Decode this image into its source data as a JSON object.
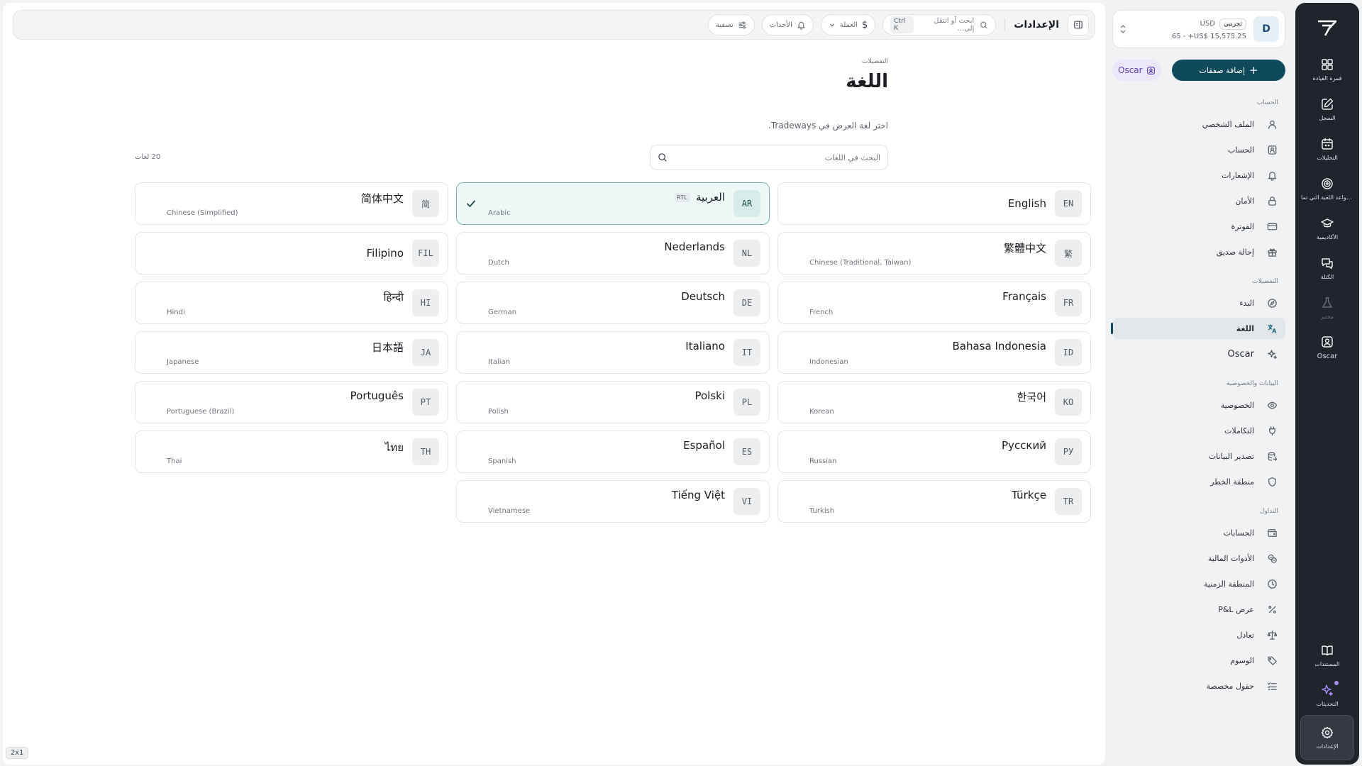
{
  "app": {
    "logo_label": "Tradeways"
  },
  "rail": {
    "items": [
      {
        "icon": "dashboard-icon",
        "label": "قمرة القيادة"
      },
      {
        "icon": "journal-icon",
        "label": "السجل"
      },
      {
        "icon": "analytics-icon",
        "label": "التحليلات"
      },
      {
        "icon": "target-icon",
        "label": "قواعد اللعبة التي تما..."
      },
      {
        "icon": "academy-icon",
        "label": "الأكاديمية"
      },
      {
        "icon": "chat-icon",
        "label": "الكتلة"
      },
      {
        "icon": "lab-icon",
        "label": "مختبر"
      },
      {
        "icon": "oscar-icon",
        "label": "Oscar"
      }
    ],
    "bottom": [
      {
        "icon": "docs-icon",
        "label": "المستندات"
      },
      {
        "icon": "updates-icon",
        "label": "التحديثات"
      },
      {
        "icon": "settings-icon",
        "label": "الإعدادات"
      }
    ]
  },
  "account": {
    "avatar": "D",
    "mode": "تجريبي",
    "currency": "USD",
    "balance": "65 - +US$ 15,575.25"
  },
  "actions": {
    "add_trades": "إضافة صفقات",
    "oscar": "Oscar"
  },
  "sidebar": {
    "sections": [
      {
        "title": "الحساب",
        "items": [
          {
            "icon": "user-icon",
            "label": "الملف الشخصي"
          },
          {
            "icon": "account-card-icon",
            "label": "الحساب"
          },
          {
            "icon": "bell-icon",
            "label": "الإشعارات"
          },
          {
            "icon": "lock-icon",
            "label": "الأمان"
          },
          {
            "icon": "credit-card-icon",
            "label": "الفوترة"
          },
          {
            "icon": "gift-icon",
            "label": "إحالة صديق"
          }
        ]
      },
      {
        "title": "التفضيلات",
        "items": [
          {
            "icon": "compass-icon",
            "label": "البدء"
          },
          {
            "icon": "translate-icon",
            "label": "اللغة"
          },
          {
            "icon": "sparkle-icon",
            "label": "Oscar"
          }
        ]
      },
      {
        "title": "البيانات والخصوصية",
        "items": [
          {
            "icon": "eye-icon",
            "label": "الخصوصية"
          },
          {
            "icon": "plug-icon",
            "label": "التكاملات"
          },
          {
            "icon": "database-export-icon",
            "label": "تصدير البيانات"
          },
          {
            "icon": "shield-icon",
            "label": "منطقة الخطر"
          }
        ]
      },
      {
        "title": "التداول",
        "items": [
          {
            "icon": "wallet-icon",
            "label": "الحسابات"
          },
          {
            "icon": "instruments-icon",
            "label": "الأدوات المالية"
          },
          {
            "icon": "clock-icon",
            "label": "المنطقة الزمنية"
          },
          {
            "icon": "percent-icon",
            "label": "عرض P&L"
          },
          {
            "icon": "scale-icon",
            "label": "تعادل"
          },
          {
            "icon": "tag-icon",
            "label": "الوسوم"
          },
          {
            "icon": "checklist-icon",
            "label": "حقول مخصصة"
          }
        ]
      }
    ]
  },
  "topbar": {
    "title": "الإعدادات",
    "search_placeholder": "ابحث أو انتقل إلى...",
    "shortcut": "Ctrl K",
    "currency": "العملة",
    "events": "الأحداث",
    "filter": "تصفية"
  },
  "page": {
    "breadcrumb": "التفضيلات",
    "title": "اللغة",
    "description": "اختر لغة العرض في Tradeways.",
    "search_placeholder": "البحث في اللغات",
    "count": "20 لغات"
  },
  "languages": [
    {
      "code": "EN",
      "native": "English",
      "english": ""
    },
    {
      "code": "AR",
      "native": "العربية",
      "english": "Arabic",
      "rtl": "RTL",
      "selected": true
    },
    {
      "code": "简",
      "native": "简体中文",
      "english": "Chinese (Simplified)"
    },
    {
      "code": "繁",
      "native": "繁體中文",
      "english": "Chinese (Traditional, Taiwan)"
    },
    {
      "code": "NL",
      "native": "Nederlands",
      "english": "Dutch"
    },
    {
      "code": "FIL",
      "native": "Filipino",
      "english": ""
    },
    {
      "code": "FR",
      "native": "Français",
      "english": "French"
    },
    {
      "code": "DE",
      "native": "Deutsch",
      "english": "German"
    },
    {
      "code": "HI",
      "native": "हिन्दी",
      "english": "Hindi"
    },
    {
      "code": "ID",
      "native": "Bahasa Indonesia",
      "english": "Indonesian"
    },
    {
      "code": "IT",
      "native": "Italiano",
      "english": "Italian"
    },
    {
      "code": "JA",
      "native": "日本語",
      "english": "Japanese"
    },
    {
      "code": "KO",
      "native": "한국어",
      "english": "Korean"
    },
    {
      "code": "PL",
      "native": "Polski",
      "english": "Polish"
    },
    {
      "code": "PT",
      "native": "Português",
      "english": "Portuguese (Brazil)"
    },
    {
      "code": "РУ",
      "native": "Русский",
      "english": "Russian"
    },
    {
      "code": "ES",
      "native": "Español",
      "english": "Spanish"
    },
    {
      "code": "TH",
      "native": "ไทย",
      "english": "Thai"
    },
    {
      "code": "TR",
      "native": "Türkçe",
      "english": "Turkish"
    },
    {
      "code": "VI",
      "native": "Tiếng Việt",
      "english": "Vietnamese"
    }
  ],
  "corner_tag": "2x1",
  "colors": {
    "accent": "#0f4a5c",
    "selected_bg": "#eef8f7",
    "selected_border": "#78b4ad",
    "rail_bg": "#20242b"
  }
}
